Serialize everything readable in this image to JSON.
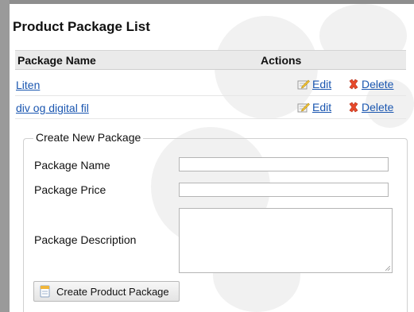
{
  "page": {
    "title": "Product Package List"
  },
  "table": {
    "headers": {
      "name": "Package Name",
      "actions": "Actions"
    },
    "rows": [
      {
        "name": "Liten",
        "edit": "Edit",
        "delete": "Delete"
      },
      {
        "name": "div og digital fil",
        "edit": "Edit",
        "delete": "Delete"
      }
    ]
  },
  "form": {
    "legend": "Create New Package",
    "name_label": "Package Name",
    "price_label": "Package Price",
    "description_label": "Package Description",
    "name_value": "",
    "price_value": "",
    "description_value": "",
    "submit_label": "Create Product Package"
  },
  "icons": {
    "edit": "pencil-notepad-icon",
    "delete": "red-x-icon",
    "submit": "document-icon"
  },
  "colors": {
    "link": "#1a56b0",
    "header_bg": "#eaeaea",
    "delete_icon": "#e8492b"
  }
}
